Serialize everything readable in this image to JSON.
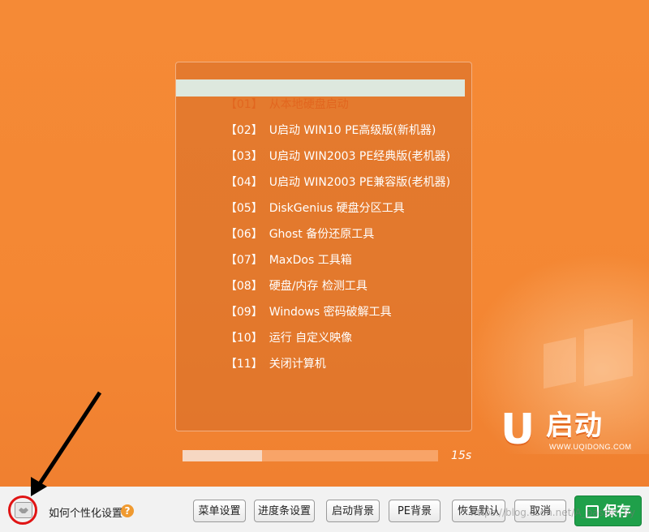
{
  "menu": {
    "items": [
      {
        "num": "【01】",
        "label": "从本地硬盘启动"
      },
      {
        "num": "【02】",
        "label": "U启动 WIN10 PE高级版(新机器)"
      },
      {
        "num": "【03】",
        "label": "U启动 WIN2003 PE经典版(老机器)"
      },
      {
        "num": "【04】",
        "label": "U启动 WIN2003 PE兼容版(老机器)"
      },
      {
        "num": "【05】",
        "label": "DiskGenius 硬盘分区工具"
      },
      {
        "num": "【06】",
        "label": "Ghost 备份还原工具"
      },
      {
        "num": "【07】",
        "label": "MaxDos 工具箱"
      },
      {
        "num": "【08】",
        "label": "硬盘/内存 检测工具"
      },
      {
        "num": "【09】",
        "label": "Windows 密码破解工具"
      },
      {
        "num": "【10】",
        "label": "运行 自定义映像"
      },
      {
        "num": "【11】",
        "label": "关闭计算机"
      }
    ],
    "selected_index": 0
  },
  "countdown": {
    "text": "15s",
    "progress_fraction": 0.31
  },
  "logo": {
    "u": "U",
    "text": "启动",
    "url": "WWW.UQIDONG.COM"
  },
  "toolbar": {
    "howto_label": "如何个性化设置",
    "help_icon": "?",
    "buttons": {
      "menu_settings": "菜单设置",
      "progress_settings": "进度条设置",
      "boot_background": "启动背景",
      "pe_background": "PE背景",
      "restore_default": "恢复默认",
      "cancel": "取消",
      "save": "保存"
    }
  },
  "watermark": "https://blog.csdn.net/A_passer_by",
  "colors": {
    "background": "#f48733",
    "highlight_bg": "#dde8de",
    "highlight_text": "#e2661f",
    "save_button": "#1fa04a",
    "annotation_ring": "#e01414"
  },
  "icons": {
    "settings": "handshake-settings-icon",
    "help": "question-circle-icon",
    "save": "floppy-disk-icon"
  }
}
